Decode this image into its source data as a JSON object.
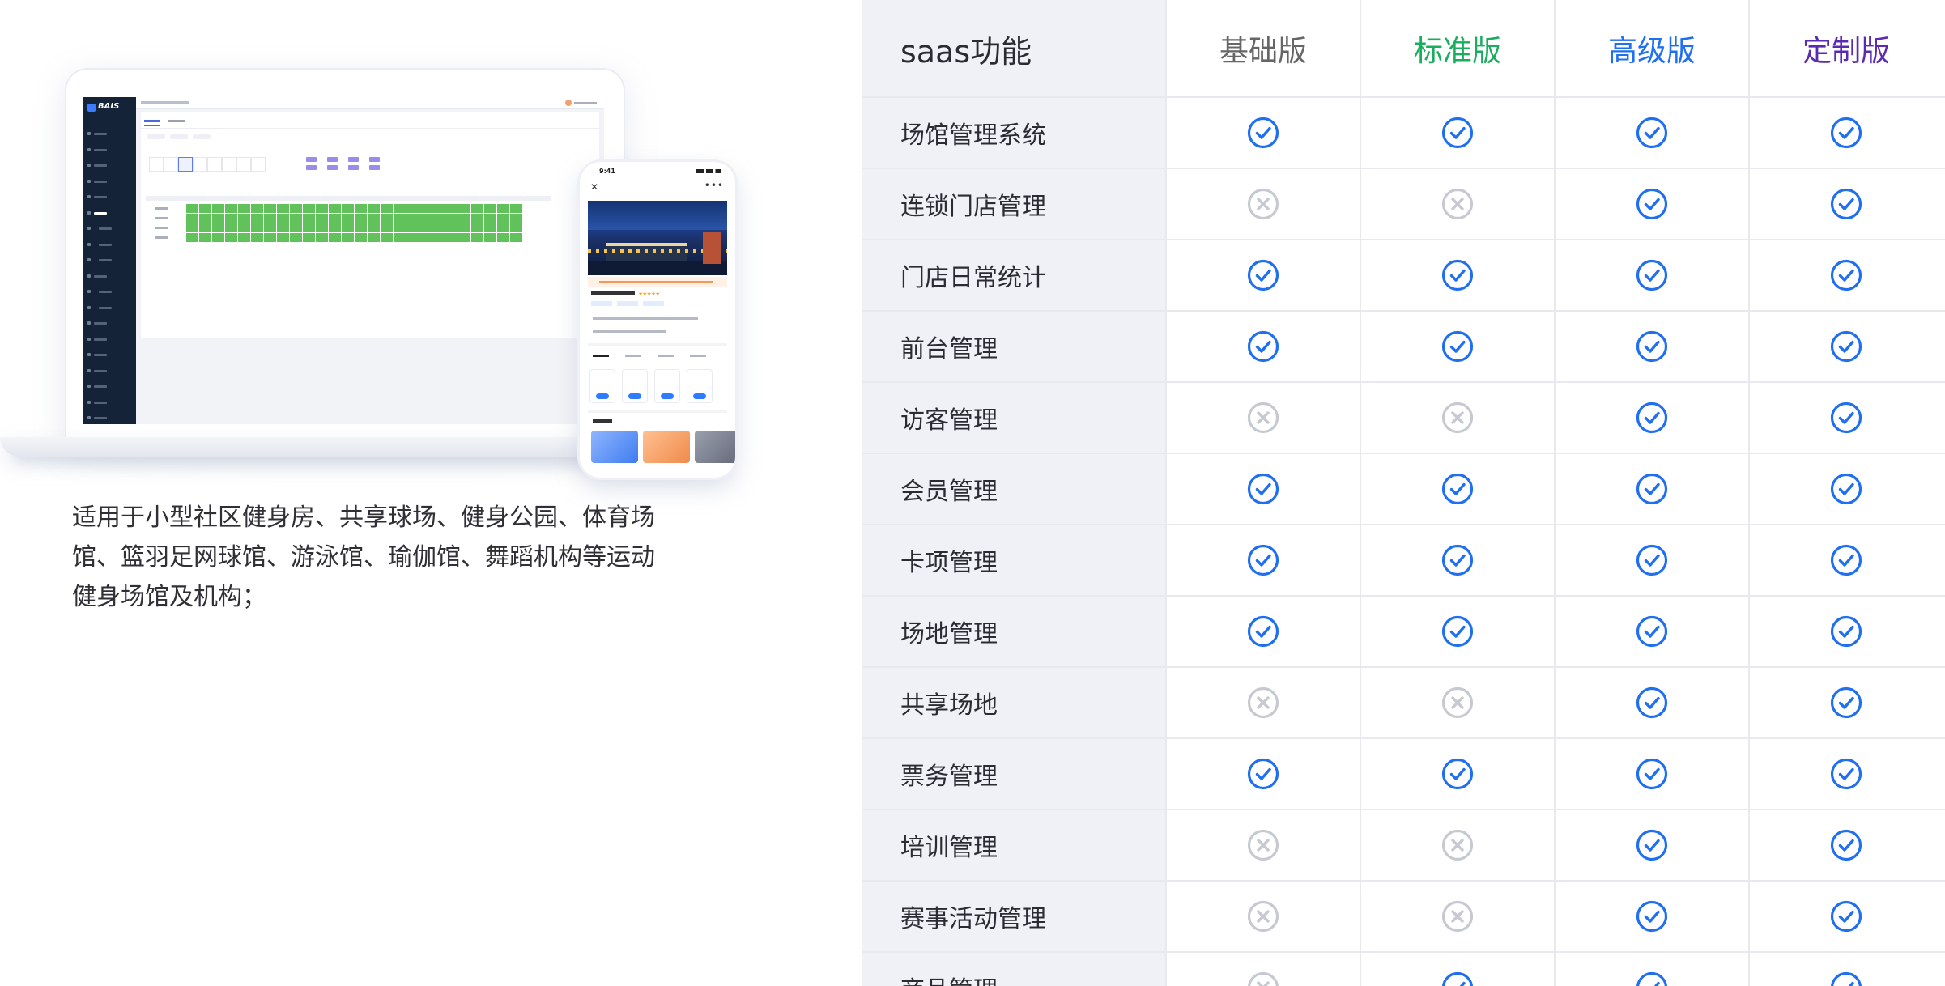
{
  "description": "适用于小型社区健身房、共享球场、健身公园、体育场馆、篮羽足网球馆、游泳馆、瑜伽馆、舞蹈机构等运动健身场馆及机构；",
  "mockup": {
    "laptop_brand": "BAIS",
    "phone_time": "9:41",
    "phone_stars": "★★★★★"
  },
  "table": {
    "header": {
      "feature": "saas功能",
      "plans": [
        {
          "label": "基础版",
          "color": "#666666"
        },
        {
          "label": "标准版",
          "color": "#1aad5e"
        },
        {
          "label": "高级版",
          "color": "#1f6ff0"
        },
        {
          "label": "定制版",
          "color": "#5a2bb0"
        }
      ]
    },
    "rows": [
      {
        "feature": "场馆管理系统",
        "support": [
          true,
          true,
          true,
          true
        ]
      },
      {
        "feature": "连锁门店管理",
        "support": [
          false,
          false,
          true,
          true
        ]
      },
      {
        "feature": "门店日常统计",
        "support": [
          true,
          true,
          true,
          true
        ]
      },
      {
        "feature": "前台管理",
        "support": [
          true,
          true,
          true,
          true
        ]
      },
      {
        "feature": "访客管理",
        "support": [
          false,
          false,
          true,
          true
        ]
      },
      {
        "feature": "会员管理",
        "support": [
          true,
          true,
          true,
          true
        ]
      },
      {
        "feature": "卡项管理",
        "support": [
          true,
          true,
          true,
          true
        ]
      },
      {
        "feature": "场地管理",
        "support": [
          true,
          true,
          true,
          true
        ]
      },
      {
        "feature": "共享场地",
        "support": [
          false,
          false,
          true,
          true
        ]
      },
      {
        "feature": "票务管理",
        "support": [
          true,
          true,
          true,
          true
        ]
      },
      {
        "feature": "培训管理",
        "support": [
          false,
          false,
          true,
          true
        ]
      },
      {
        "feature": "赛事活动管理",
        "support": [
          false,
          false,
          true,
          true
        ]
      },
      {
        "feature": "商品管理",
        "support": [
          false,
          true,
          true,
          true
        ]
      }
    ],
    "icons": {
      "supported": "check-circle-icon",
      "unsupported": "x-circle-icon"
    },
    "colors": {
      "check": "#1f6ff0",
      "cross": "#c6c9d1"
    }
  }
}
